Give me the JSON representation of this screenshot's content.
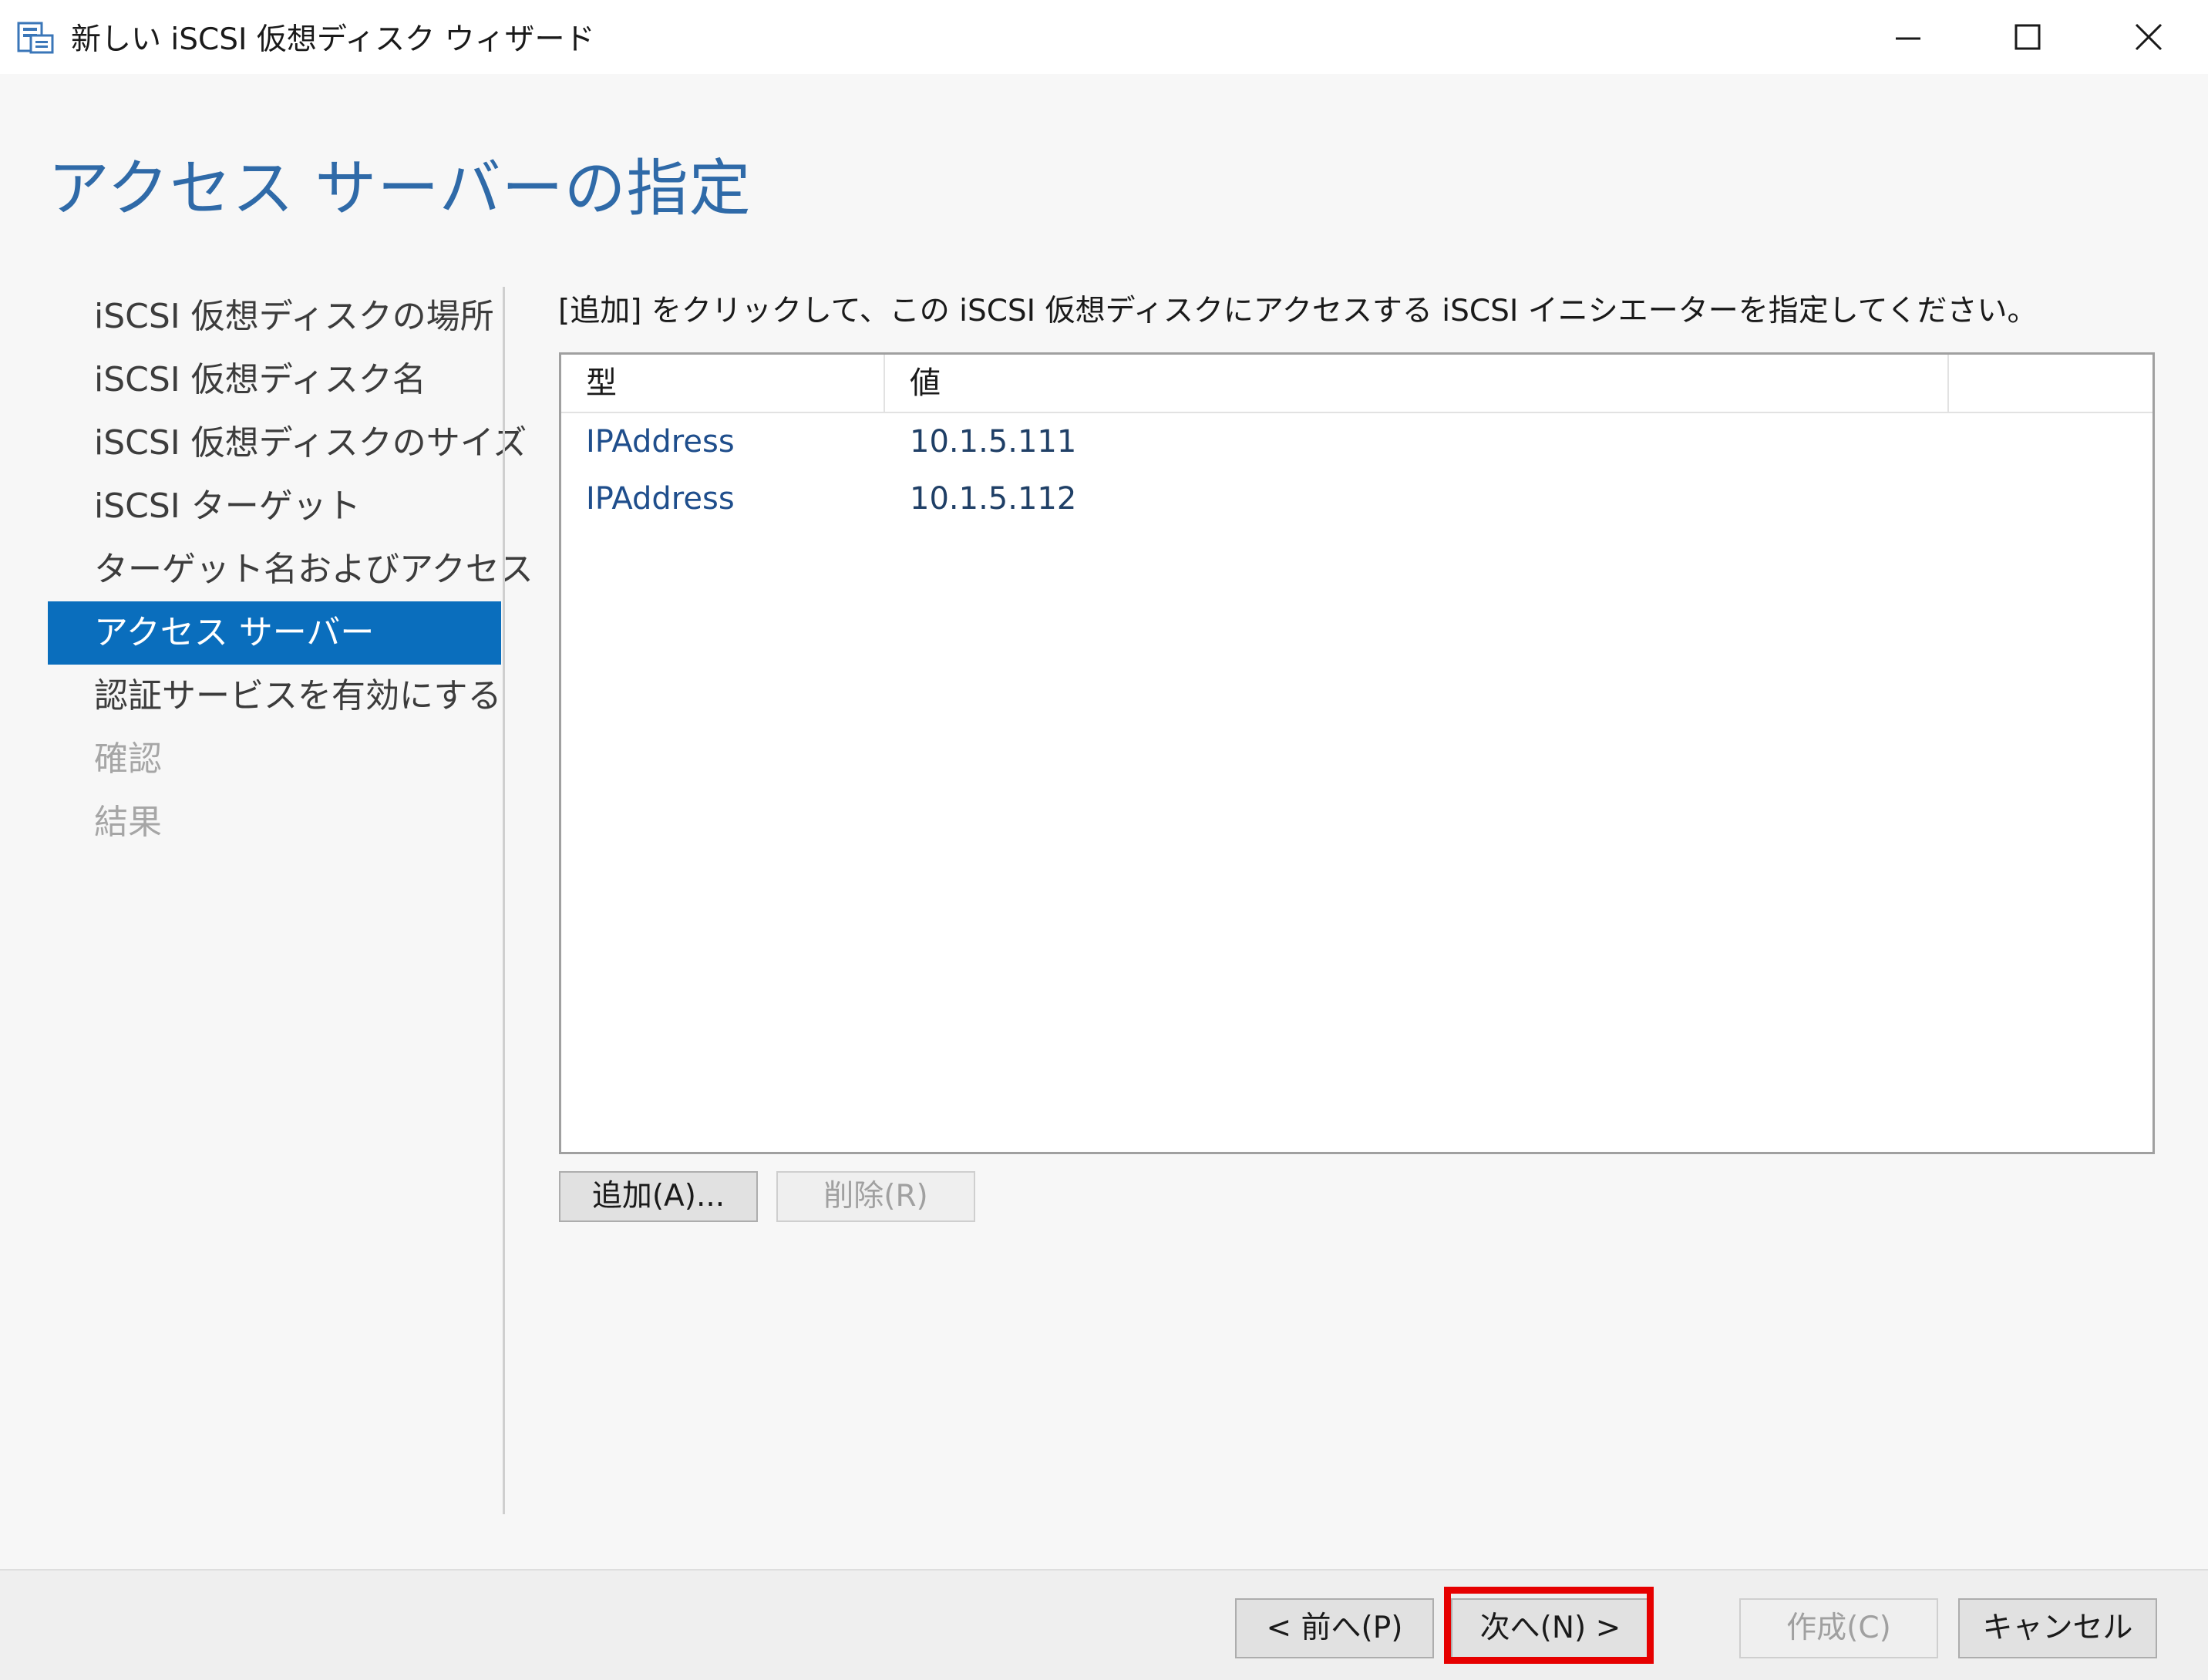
{
  "window": {
    "title": "新しい iSCSI 仮想ディスク ウィザード",
    "controls": {
      "minimize": "minimize-icon",
      "maximize": "maximize-icon",
      "close": "close-icon"
    }
  },
  "page": {
    "heading": "アクセス サーバーの指定"
  },
  "nav": {
    "items": [
      {
        "label": "iSCSI 仮想ディスクの場所",
        "state": "normal"
      },
      {
        "label": "iSCSI 仮想ディスク名",
        "state": "normal"
      },
      {
        "label": "iSCSI 仮想ディスクのサイズ",
        "state": "normal"
      },
      {
        "label": "iSCSI ターゲット",
        "state": "normal"
      },
      {
        "label": "ターゲット名およびアクセス",
        "state": "normal"
      },
      {
        "label": "アクセス サーバー",
        "state": "active"
      },
      {
        "label": "認証サービスを有効にする",
        "state": "normal"
      },
      {
        "label": "確認",
        "state": "disabled"
      },
      {
        "label": "結果",
        "state": "disabled"
      }
    ]
  },
  "content": {
    "instruction": "[追加] をクリックして、この iSCSI 仮想ディスクにアクセスする iSCSI イニシエーターを指定してください。",
    "table": {
      "columns": [
        "型",
        "値"
      ],
      "rows": [
        {
          "type": "IPAddress",
          "value": "10.1.5.111"
        },
        {
          "type": "IPAddress",
          "value": "10.1.5.112"
        }
      ]
    },
    "add_label": "追加(A)...",
    "remove_label": "削除(R)"
  },
  "footer": {
    "prev_label": "< 前へ(P)",
    "next_label": "次へ(N) >",
    "create_label": "作成(C)",
    "cancel_label": "キャンセル"
  },
  "colors": {
    "accent": "#0a6ebd",
    "heading": "#2f6aa8",
    "highlight": "#e60000"
  }
}
